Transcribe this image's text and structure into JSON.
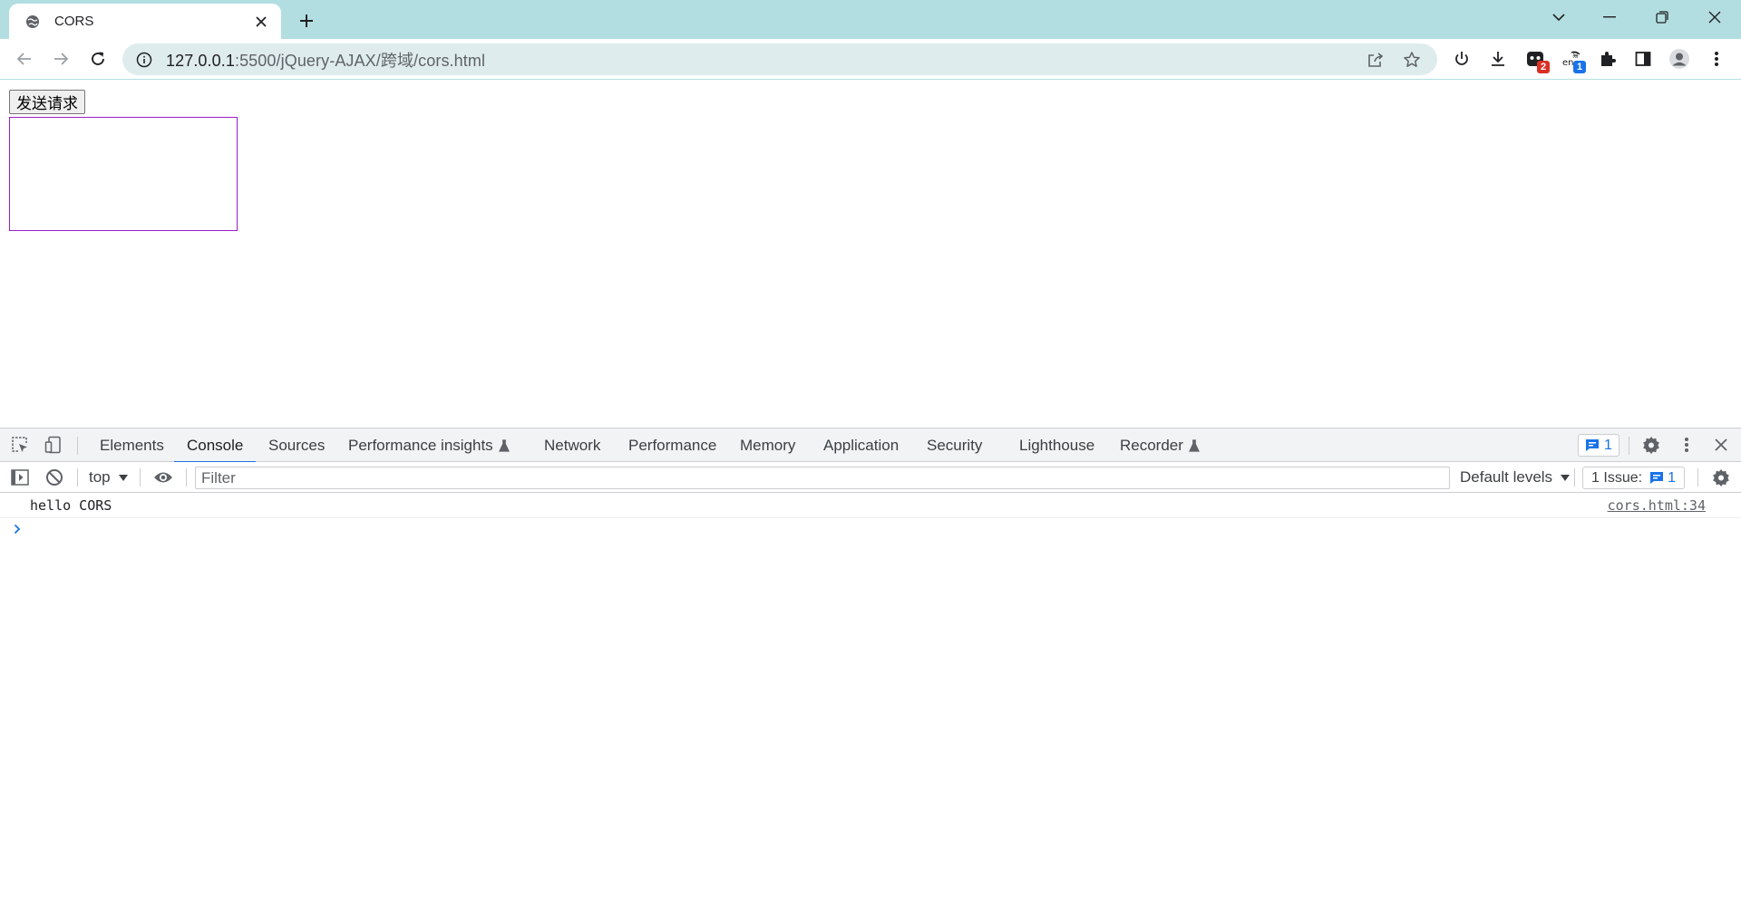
{
  "browser": {
    "tab": {
      "title": "CORS"
    },
    "omnibox": {
      "url_host": "127.0.0.1",
      "url_path": ":5500/jQuery-AJAX/跨域/cors.html"
    },
    "extensions": {
      "ext1_badge": "2",
      "ext2_badge": "1",
      "ext2_badge_color": "#1a73e8",
      "ext1_badge_color": "#d93025"
    },
    "frame_color": "#b3dee1"
  },
  "page": {
    "send_button_label": "发送请求",
    "result_box_border_color": "#9b1fc7"
  },
  "devtools": {
    "tabs": [
      {
        "label": "Elements"
      },
      {
        "label": "Console"
      },
      {
        "label": "Sources"
      },
      {
        "label": "Performance insights"
      },
      {
        "label": "Network"
      },
      {
        "label": "Performance"
      },
      {
        "label": "Memory"
      },
      {
        "label": "Application"
      },
      {
        "label": "Security"
      },
      {
        "label": "Lighthouse"
      },
      {
        "label": "Recorder"
      }
    ],
    "active_tab": "Console",
    "issues_count": "1",
    "console_bar": {
      "context": "top",
      "filter_placeholder": "Filter",
      "levels": "Default levels",
      "issue_label": "1 Issue:",
      "issue_count": "1"
    },
    "console": {
      "messages": [
        {
          "text": "hello CORS",
          "source": "cors.html:34"
        }
      ]
    },
    "accent_color": "#1a73e8"
  }
}
